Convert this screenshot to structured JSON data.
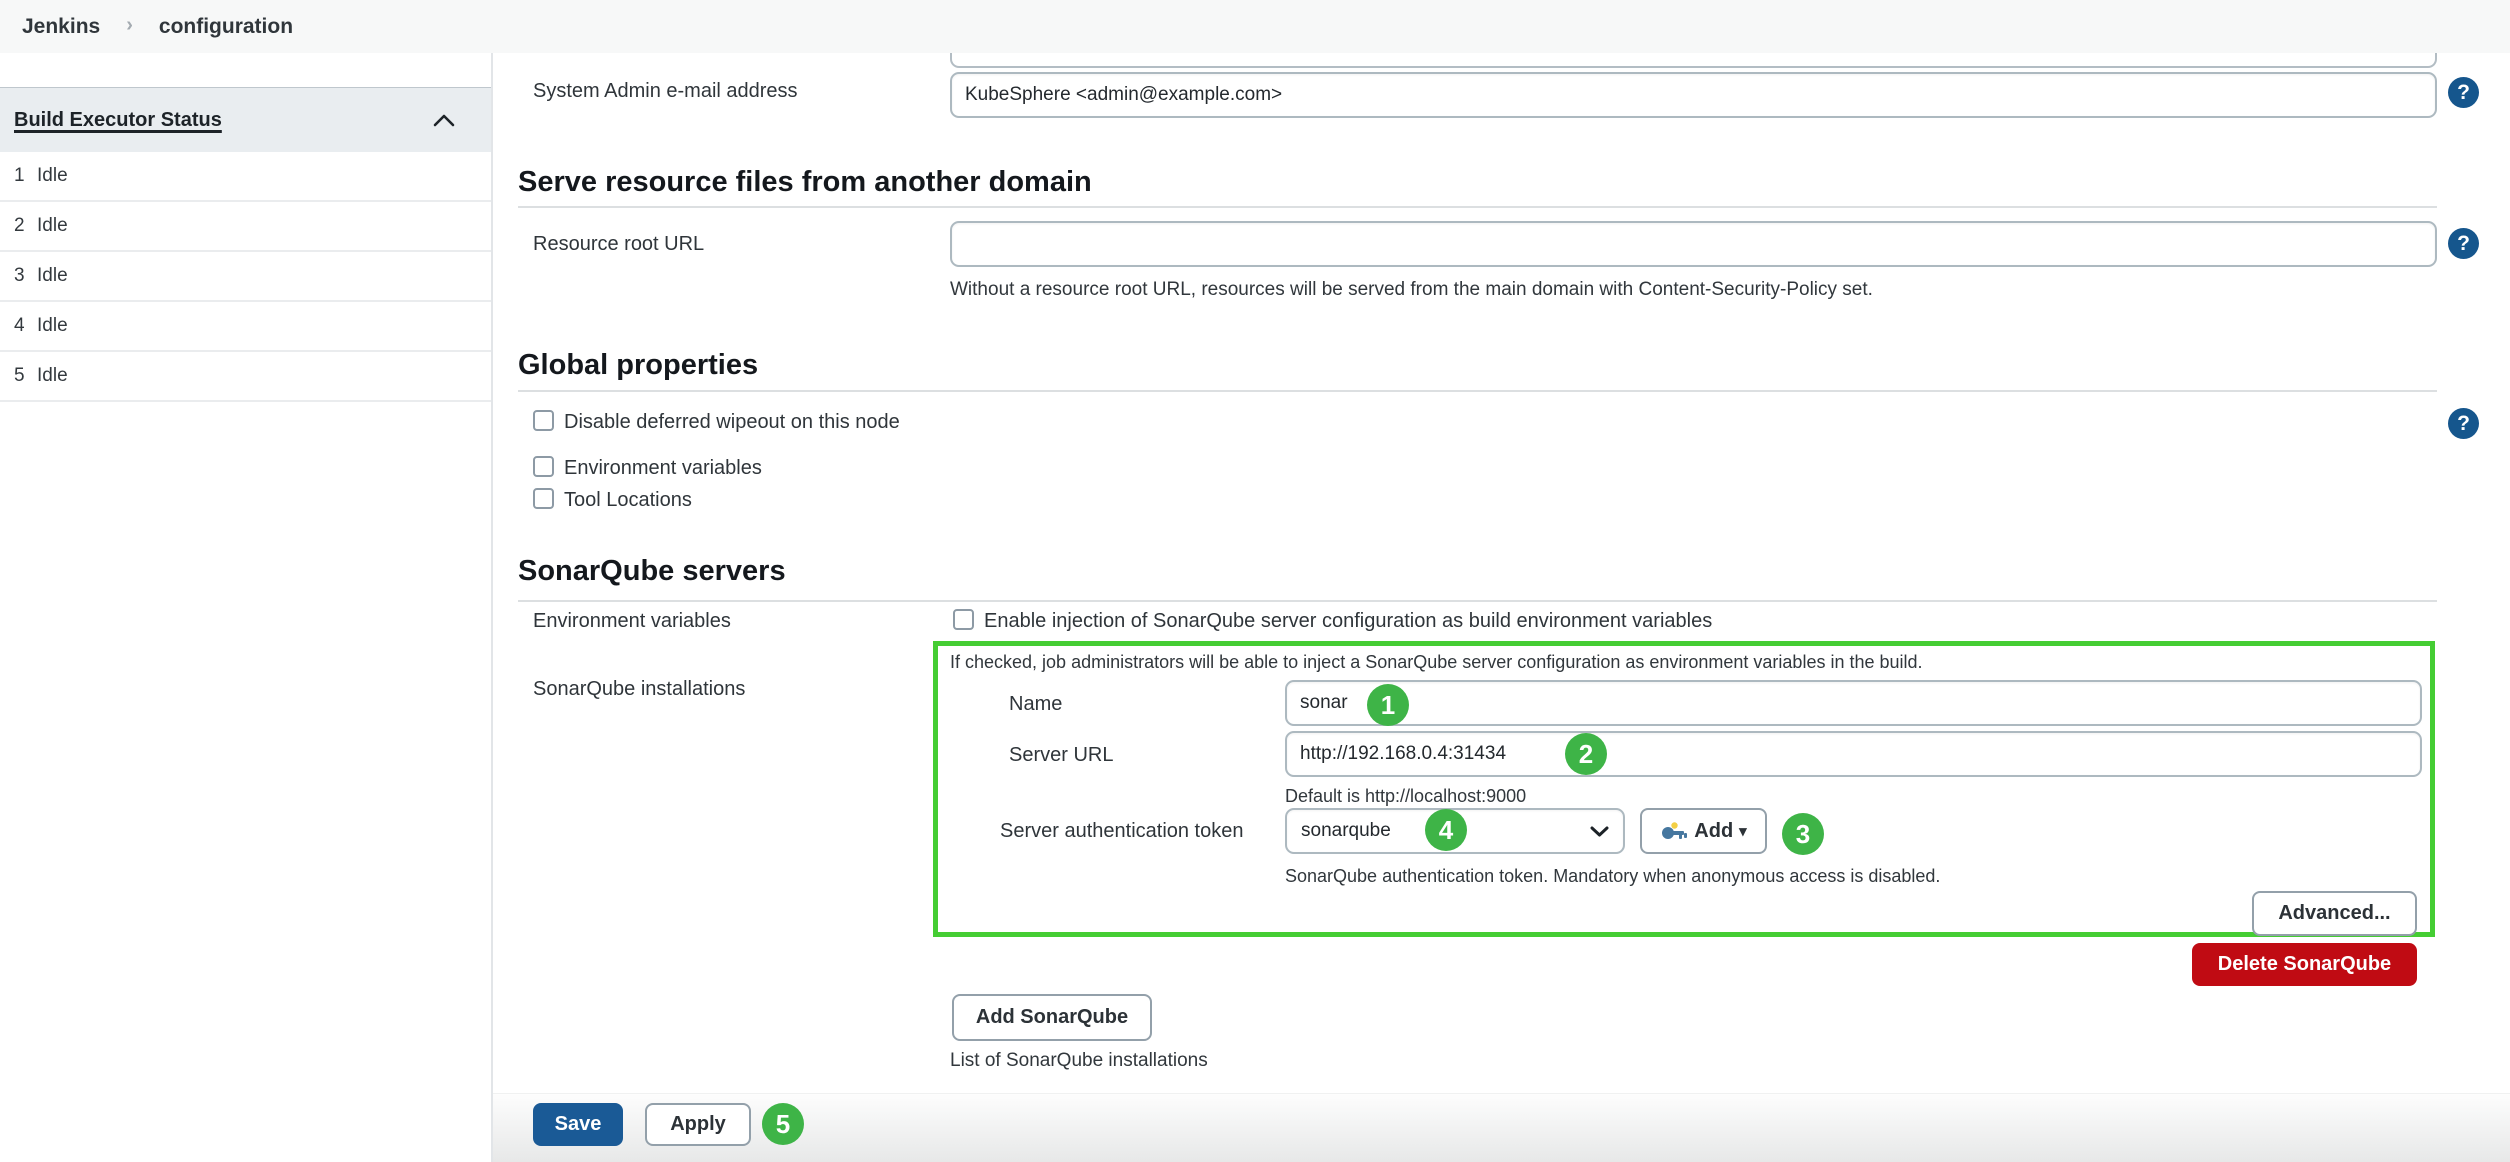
{
  "breadcrumb": {
    "root": "Jenkins",
    "separator": "›",
    "current": "configuration"
  },
  "sidebar": {
    "title": "Build Executor Status",
    "executors": [
      {
        "number": "1",
        "status": "Idle"
      },
      {
        "number": "2",
        "status": "Idle"
      },
      {
        "number": "3",
        "status": "Idle"
      },
      {
        "number": "4",
        "status": "Idle"
      },
      {
        "number": "5",
        "status": "Idle"
      }
    ]
  },
  "system_admin_email": {
    "label": "System Admin e-mail address",
    "value": "KubeSphere <admin@example.com>"
  },
  "serve_resources": {
    "title": "Serve resource files from another domain",
    "resource_root": {
      "label": "Resource root URL",
      "value": "",
      "help": "Without a resource root URL, resources will be served from the main domain with Content-Security-Policy set."
    }
  },
  "global_properties": {
    "title": "Global properties",
    "options": [
      {
        "label": "Disable deferred wipeout on this node",
        "checked": false
      },
      {
        "label": "Environment variables",
        "checked": false
      },
      {
        "label": "Tool Locations",
        "checked": false
      }
    ]
  },
  "sonarqube": {
    "title": "SonarQube servers",
    "environment_variables": {
      "label": "Environment variables",
      "checkbox_label": "Enable injection of SonarQube server configuration as build environment variables",
      "checked": false,
      "help": "If checked, job administrators will be able to inject a SonarQube server configuration as environment variables in the build."
    },
    "installations_label": "SonarQube installations",
    "installation": {
      "name": {
        "label": "Name",
        "value": "sonar"
      },
      "server_url": {
        "label": "Server URL",
        "value": "http://192.168.0.4:31434",
        "help": "Default is http://localhost:9000"
      },
      "auth_token": {
        "label": "Server authentication token",
        "selected": "sonarqube",
        "add_label": "Add",
        "help": "SonarQube authentication token. Mandatory when anonymous access is disabled."
      },
      "advanced_label": "Advanced...",
      "delete_label": "Delete SonarQube"
    },
    "add_button_label": "Add SonarQube",
    "list_caption": "List of SonarQube installations"
  },
  "footer": {
    "save_label": "Save",
    "apply_label": "Apply"
  },
  "annotations": {
    "badges": [
      "1",
      "2",
      "3",
      "4",
      "5"
    ]
  },
  "help_icon_glyph": "?",
  "colors": {
    "annotation_badge_green": "#3eb447",
    "annotation_box_green": "#45cd33",
    "save_blue": "#1a5a96",
    "delete_red": "#c00b13",
    "help_blue": "#15568d"
  }
}
